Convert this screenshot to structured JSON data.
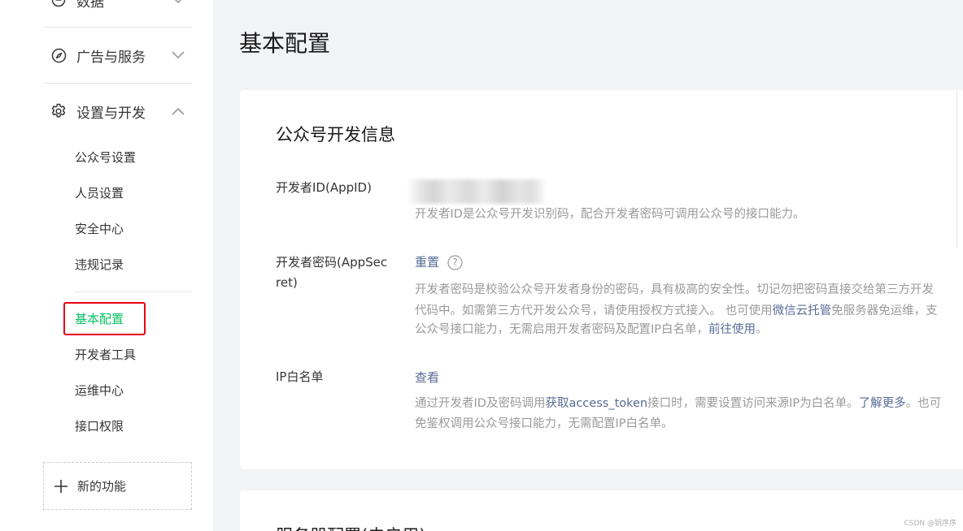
{
  "sidebar": {
    "groups": [
      {
        "label": "数据",
        "icon": "clock-icon"
      },
      {
        "label": "广告与服务",
        "icon": "compass-icon"
      },
      {
        "label": "设置与开发",
        "icon": "gear-icon"
      }
    ],
    "sub_items": [
      "公众号设置",
      "人员设置",
      "安全中心",
      "违规记录"
    ],
    "dev_items": [
      "基本配置",
      "开发者工具",
      "运维中心",
      "接口权限"
    ],
    "new_feature": "新的功能"
  },
  "main": {
    "title": "基本配置",
    "card": {
      "title": "公众号开发信息",
      "appid": {
        "label": "开发者ID(AppID)",
        "desc": "开发者ID是公众号开发识别码，配合开发者密码可调用公众号的接口能力。"
      },
      "secret": {
        "label_line1": "开发者密码(AppSec",
        "label_line2": "ret)",
        "action": "重置",
        "help": "?",
        "desc1": "开发者密码是校验公众号开发者身份的密码，具有极高的安全性。切记勿把密码直接交给第三方开发",
        "desc2_a": "代码中。如需第三方代开发公众号，请使用授权方式接入。 也可使用",
        "desc2_link": "微信云托管",
        "desc2_b": "免服务器免运维，支",
        "desc3_a": "公众号接口能力，无需启用开发者密码及配置IP白名单，",
        "desc3_link": "前往使用",
        "desc3_b": "。"
      },
      "ip": {
        "label": "IP白名单",
        "action": "查看",
        "desc1_a": "通过开发者ID及密码调用",
        "desc1_link": "获取access_token",
        "desc1_b": "接口时，需要设置访问来源IP为白名单。",
        "desc1_link2": "了解更多",
        "desc1_c": "。也可",
        "desc2": "免鉴权调用公众号接口能力，无需配置IP白名单。"
      }
    },
    "next_card_title": "服务器配置(未启用)"
  },
  "watermark": "CSDN @钥序序",
  "colors": {
    "accent_green": "#07c160",
    "link_blue": "#576b95",
    "highlight_red": "#e60012"
  }
}
